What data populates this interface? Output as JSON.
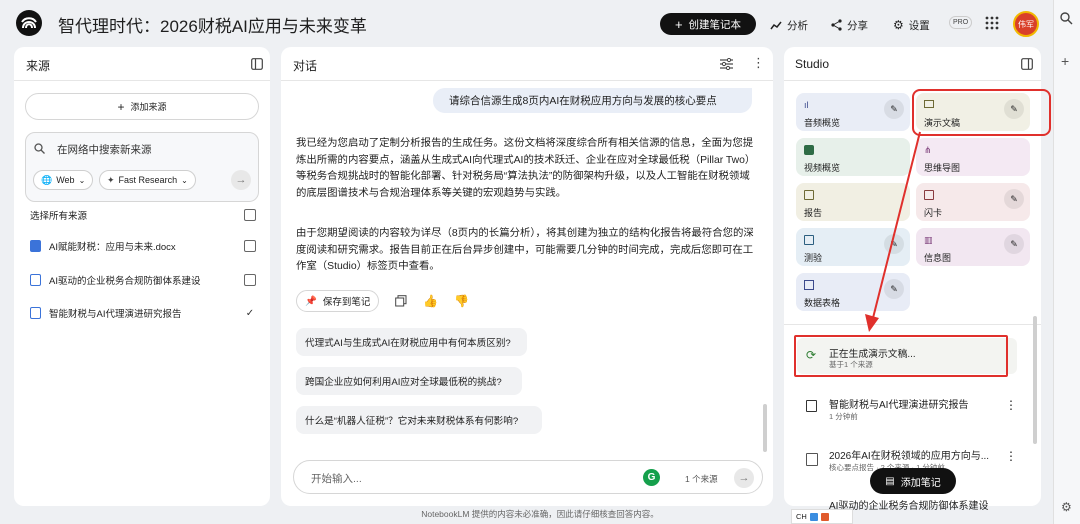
{
  "header": {
    "title": "智代理时代：2026财税AI应用与未来变革",
    "create_label": "创建笔记本",
    "analyze_label": "分析",
    "share_label": "分享",
    "settings_label": "设置",
    "pro_label": "PRO",
    "avatar_text": "伟军"
  },
  "sources": {
    "title": "来源",
    "add_label": "添加来源",
    "search_placeholder": "在网络中搜索新来源",
    "web_chip": "Web",
    "research_chip": "Fast Research",
    "select_all": "选择所有来源",
    "items": [
      {
        "name": "AI赋能财税：应用与未来.docx",
        "checked": false
      },
      {
        "name": "AI驱动的企业税务合规防御体系建设",
        "checked": false
      },
      {
        "name": "智能财税与AI代理演进研究报告",
        "checked": true
      }
    ]
  },
  "chat": {
    "title": "对话",
    "user_message": "请综合信源生成8页内AI在财税应用方向与发展的核心要点",
    "response_p1": "我已经为您启动了定制分析报告的生成任务。这份文档将深度综合所有相关信源的信息，全面为您提炼出所需的内容要点，涵盖从生成式AI向代理式AI的技术跃迁、企业在应对全球最低税（Pillar Two）等税务合规挑战时的智能化部署、针对税务局“算法执法”的防御架构升级，以及人工智能在财税领域的底层图谱技术与合规治理体系等关键的宏观趋势与实践。",
    "response_p2": "由于您期望阅读的内容较为详尽（8页内的长篇分析），将其创建为独立的结构化报告将最符合您的深度阅读和研究需求。报告目前正在后台异步创建中，可能需要几分钟的时间完成，完成后您即可在工作室（Studio）标签页中查看。",
    "save_note_label": "保存到笔记",
    "suggestions": [
      "代理式AI与生成式AI在财税应用中有何本质区别?",
      "跨国企业应如何利用AI应对全球最低税的挑战?",
      "什么是“机器人征税”？它对未来财税体系有何影响?"
    ],
    "input_placeholder": "开始输入...",
    "source_count": "1 个来源",
    "footer": "NotebookLM 提供的内容未必准确，因此请仔细核查回答内容。"
  },
  "studio": {
    "title": "Studio",
    "tiles": [
      {
        "label": "音频概览",
        "icon": "audio-wave-icon",
        "color": "#e9edf6"
      },
      {
        "label": "演示文稿",
        "icon": "slides-icon",
        "color": "#f1f0e5"
      },
      {
        "label": "视频概览",
        "icon": "video-icon",
        "color": "#e7f0ea"
      },
      {
        "label": "思维导图",
        "icon": "mindmap-icon",
        "color": "#f4e9f3"
      },
      {
        "label": "报告",
        "icon": "report-icon",
        "color": "#f1efe3"
      },
      {
        "label": "闪卡",
        "icon": "flashcard-icon",
        "color": "#f6e9ea"
      },
      {
        "label": "测验",
        "icon": "quiz-icon",
        "color": "#e5eef5"
      },
      {
        "label": "信息图",
        "icon": "infographic-icon",
        "color": "#f2e7f1"
      },
      {
        "label": "数据表格",
        "icon": "table-icon",
        "color": "#e8ecf6"
      }
    ],
    "generating_title": "正在生成演示文稿...",
    "generating_sub": "基于1 个来源",
    "notes": [
      {
        "title": "智能财税与AI代理演进研究报告",
        "sub": "1 分钟前"
      },
      {
        "title": "2026年AI在财税领域的应用方向与...",
        "sub": "核心要点报告 · 2 个来源 · 1 分钟前"
      },
      {
        "title": "AI驱动的企业税务合规防御体系建设",
        "sub": ""
      }
    ],
    "add_note_label": "添加笔记"
  },
  "taskbar": {
    "ime_label": "CH"
  },
  "colors": {
    "accent_dark": "#121212",
    "highlight_red": "#e0302c"
  }
}
